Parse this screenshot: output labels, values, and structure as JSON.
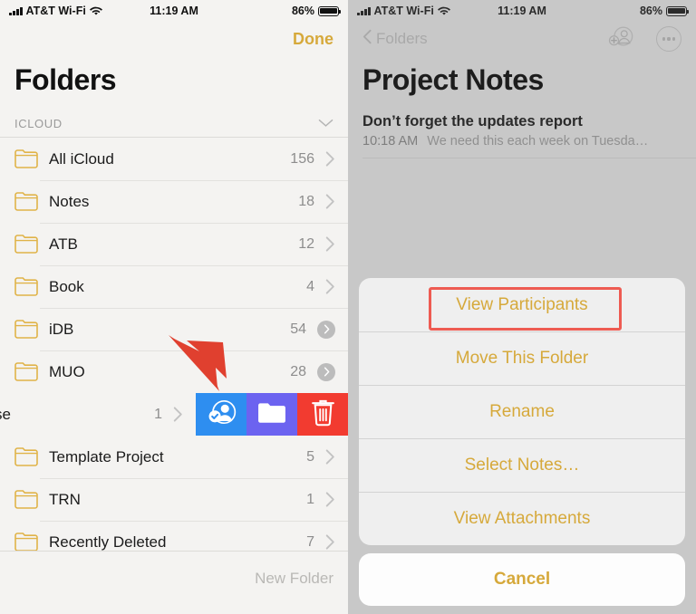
{
  "status_bar": {
    "carrier": "AT&T Wi-Fi",
    "time": "11:19 AM",
    "battery_percent": "86%",
    "signal_icon": "signal-bars-icon",
    "wifi_icon": "wifi-icon",
    "battery_icon": "battery-icon"
  },
  "left_panel": {
    "done_label": "Done",
    "title": "Folders",
    "section": {
      "label": "ICLOUD",
      "collapse_icon": "chevron-down-icon"
    },
    "folders": [
      {
        "name": "All iCloud",
        "count": "156",
        "accessory": "chevron"
      },
      {
        "name": "Notes",
        "count": "18",
        "accessory": "chevron"
      },
      {
        "name": "ATB",
        "count": "12",
        "accessory": "chevron"
      },
      {
        "name": "Book",
        "count": "4",
        "accessory": "chevron"
      },
      {
        "name": "iDB",
        "count": "54",
        "accessory": "chevron-circle"
      },
      {
        "name": "MUO",
        "count": "28",
        "accessory": "chevron-circle"
      }
    ],
    "swiped_row": {
      "name_visible": "se",
      "count": "1",
      "accessory": "chevron",
      "actions": [
        {
          "name": "share-folder-action",
          "icon": "person-check-icon",
          "color": "#2e8ef0"
        },
        {
          "name": "move-folder-action",
          "icon": "folder-icon",
          "color": "#6c63f0"
        },
        {
          "name": "delete-folder-action",
          "icon": "trash-icon",
          "color": "#f23b30"
        }
      ]
    },
    "folders_after": [
      {
        "name": "Template Project",
        "count": "5",
        "accessory": "chevron"
      },
      {
        "name": "TRN",
        "count": "1",
        "accessory": "chevron"
      },
      {
        "name": "Recently Deleted",
        "count": "7",
        "accessory": "chevron"
      }
    ],
    "new_folder_label": "New Folder"
  },
  "right_panel": {
    "back_label": "Folders",
    "back_icon": "chevron-left-icon",
    "add_person_icon": "add-person-icon",
    "more_icon": "more-ellipsis-icon",
    "title": "Project Notes",
    "note": {
      "title": "Don’t forget the updates report",
      "time": "10:18 AM",
      "preview": "We need this each week on Tuesda…"
    },
    "action_sheet": {
      "items": [
        "View Participants",
        "Move This Folder",
        "Rename",
        "Select Notes…",
        "View Attachments"
      ],
      "cancel_label": "Cancel",
      "highlighted_item_index": 0
    }
  },
  "annotations": {
    "highlight_color": "#ee5b52",
    "arrow_color": "#e0402f",
    "highlight_target": "View Participants",
    "arrow_target": "share-folder-action"
  },
  "colors": {
    "accent_yellow": "#d6a93b",
    "folder_yellow": "#e8b84b",
    "share_blue": "#2e8ef0",
    "move_purple": "#6c63f0",
    "delete_red": "#f23b30"
  }
}
